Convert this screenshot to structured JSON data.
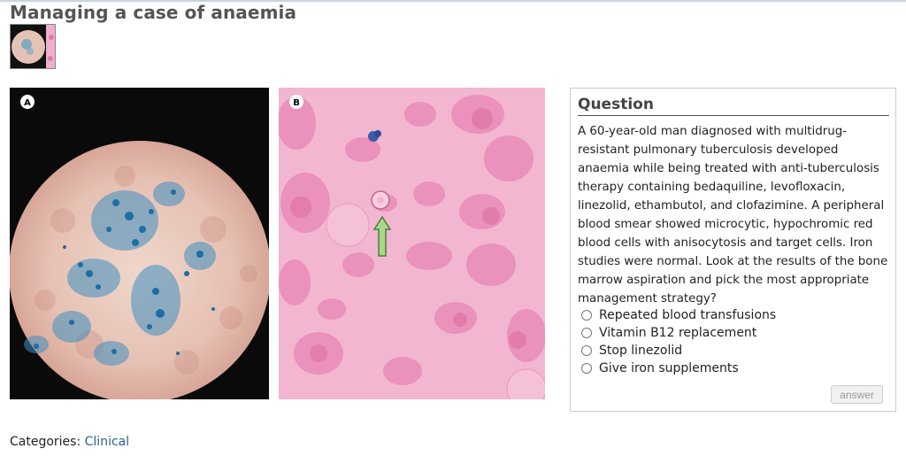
{
  "page": {
    "title": "Managing a case of anaemia"
  },
  "figure": {
    "panel_a_label": "A",
    "panel_b_label": "B"
  },
  "question": {
    "heading": "Question",
    "text": "A 60-year-old man diagnosed with multidrug-resistant pulmonary tuberculosis developed anaemia while being treated with anti-tuberculosis therapy containing bedaquiline, levofloxacin, linezolid, ethambutol, and clofazimine. A peripheral blood smear showed microcytic, hypochromic red blood cells with anisocytosis and target cells. Iron studies were normal. Look at the results of the bone marrow aspiration and pick the most appropriate management strategy?",
    "options": [
      "Repeated blood transfusions",
      "Vitamin B12 replacement",
      "Stop linezolid",
      "Give iron supplements"
    ],
    "answer_label": "answer"
  },
  "footer": {
    "categories_label": "Categories:",
    "category_link": "Clinical"
  }
}
